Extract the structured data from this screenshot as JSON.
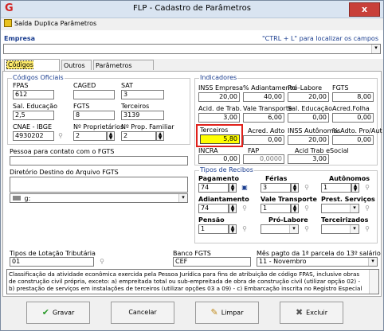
{
  "window": {
    "title": "FLP - Cadastro de Parâmetros",
    "close_glyph": "x",
    "app_icon_glyph": "G"
  },
  "menu": {
    "items": [
      "Saída",
      "Duplica Parâmetros"
    ]
  },
  "empresa": {
    "label": "Empresa",
    "hint": "\"CTRL + L\" para localizar os campos",
    "value": ""
  },
  "tabs": [
    "Códigos Oficiais",
    "Outros",
    "Parâmetros Internos"
  ],
  "codigos": {
    "title": "Códigos Oficiais",
    "fpas": {
      "label": "FPAS",
      "value": "612"
    },
    "caged": {
      "label": "CAGED",
      "value": ""
    },
    "sat": {
      "label": "SAT",
      "value": "3"
    },
    "sal_educacao": {
      "label": "Sal. Educação",
      "value": "2,5"
    },
    "fgts": {
      "label": "FGTS",
      "value": "8"
    },
    "terceiros": {
      "label": "Terceiros",
      "value": "3139"
    },
    "cnae": {
      "label": "CNAE - IBGE",
      "value": "4930202"
    },
    "num_proprietarios": {
      "label": "Nº Proprietários",
      "value": "2"
    },
    "num_prop_familiar": {
      "label": "Nº Prop. Familiar",
      "value": "2"
    },
    "contato_label": "Pessoa para contato com o FGTS",
    "contato_value": "",
    "diretorio_label": "Diretório Destino do Arquivo FGTS",
    "diretorio_value": "",
    "drive_value": "g:"
  },
  "indicadores": {
    "title": "Indicadores",
    "inss_empresa": {
      "label": "INSS Empresa",
      "value": "20,00"
    },
    "adiantamento": {
      "label": "% Adiantamento",
      "value": "40,00"
    },
    "pro_labore": {
      "label": "Pró-Labore",
      "value": "20,00"
    },
    "fgts": {
      "label": "FGTS",
      "value": "8,00"
    },
    "acid_trab": {
      "label": "Acid. de Trab.",
      "value": "3,00"
    },
    "vale_transporte": {
      "label": "Vale Transporte",
      "value": "6,00"
    },
    "sal_educacao": {
      "label": "Sal. Educação",
      "value": "0,00"
    },
    "acred_folha": {
      "label": "Acred.Folha",
      "value": "0,00"
    },
    "terceiros": {
      "label": "Terceiros",
      "value": "5,80"
    },
    "acred_adto": {
      "label": "Acred. Adto",
      "value": "0,00"
    },
    "inss_autonomos": {
      "label": "INSS Autônomos",
      "value": "20,00"
    },
    "adto_pro_aut": {
      "label": "% Adto. Pro/Aut",
      "value": "0,00"
    },
    "incra": {
      "label": "INCRA",
      "value": "0,00"
    },
    "fap": {
      "label": "FAP",
      "value": "0,0000"
    },
    "acid_trab_esocial": {
      "label": "Acid Trab eSocial",
      "value": "3,00"
    }
  },
  "recibos": {
    "title": "Tipos de Recibos",
    "pagamento": {
      "label": "Pagamento",
      "value": "74"
    },
    "ferias": {
      "label": "Férias",
      "value": "3"
    },
    "autonomos": {
      "label": "Autônomos",
      "value": "1"
    },
    "adiantamento": {
      "label": "Adiantamento",
      "value": "74"
    },
    "vale_transporte": {
      "label": "Vale Transporte",
      "value": "1"
    },
    "prest_servicos": {
      "label": "Prest. Serviços",
      "value": ""
    },
    "pensao": {
      "label": "Pensão",
      "value": "1"
    },
    "pro_labore": {
      "label": "Pró-Labore",
      "value": ""
    },
    "terceirizados": {
      "label": "Terceirizados",
      "value": ""
    }
  },
  "lotacao": {
    "label": "Tipos de Lotação Tributária",
    "value": "01"
  },
  "banco": {
    "label": "Banco FGTS",
    "value": "CEF"
  },
  "mes13": {
    "label": "Mês pagto da 1ª parcela do 13º salário",
    "value": "11 - Novembro"
  },
  "descricao": "Classificação da atividade econômica exercida pela Pessoa Jurídica para fins de atribuição de código FPAS, inclusive obras de construção civil própria, exceto: a) empreitada total ou sub-empreitada de obra de construção civil (utilizar opção 02) - b) prestação de serviços em instalações de terceiros (utilizar opções 03 a 09) - c) Embarcação inscrita no Registro Especial",
  "buttons": {
    "gravar": "Gravar",
    "cancelar": "Cancelar",
    "limpar": "Limpar",
    "excluir": "Excluir"
  },
  "colors": {
    "highlight": "#ffff00",
    "annotation_box": "#e0201a",
    "group_title": "#1a3d8f"
  },
  "icons": [
    "app-icon",
    "close-icon",
    "exit-icon",
    "search-binoculars-icon",
    "print-icon",
    "check-icon",
    "clean-icon",
    "delete-icon",
    "drive-icon"
  ]
}
